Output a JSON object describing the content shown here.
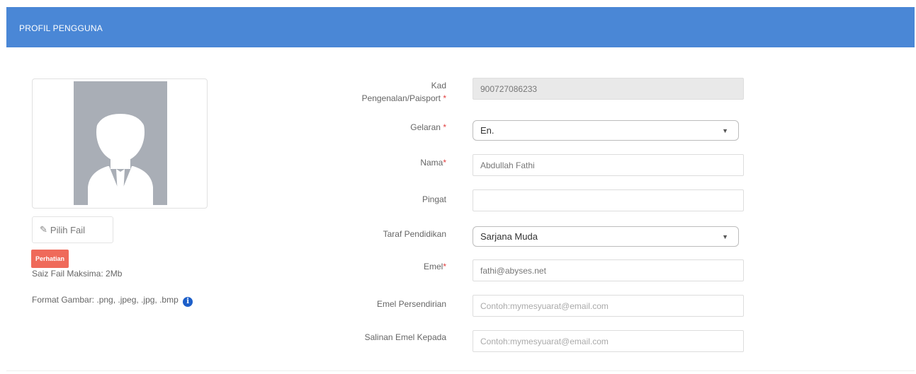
{
  "header": {
    "title": "PROFIL PENGGUNA"
  },
  "photo": {
    "choose_file_label": "Pilih Fail",
    "note_badge": "Perhatian",
    "max_size_text": "Saiz Fail Maksima: 2Mb",
    "format_text": "Format Gambar: .png, .jpeg, .jpg, .bmp"
  },
  "form": {
    "ic": {
      "label_line1": "Kad",
      "label_line2": "Pengenalan/Paisport",
      "value": "900727086233"
    },
    "title": {
      "label": "Gelaran",
      "value": "En."
    },
    "name": {
      "label": "Nama",
      "value": "Abdullah Fathi"
    },
    "award": {
      "label": "Pingat",
      "value": ""
    },
    "education": {
      "label": "Taraf Pendidikan",
      "value": "Sarjana Muda"
    },
    "email": {
      "label": "Emel",
      "value": "fathi@abyses.net"
    },
    "personal_email": {
      "label": "Emel Persendirian",
      "placeholder": "Contoh:mymesyuarat@email.com"
    },
    "cc_email": {
      "label": "Salinan Emel Kepada",
      "placeholder": "Contoh:mymesyuarat@email.com"
    }
  },
  "colors": {
    "header": "#4a87d6",
    "badge": "#ef6a5a",
    "required": "#e14040",
    "info": "#1d5fc9"
  }
}
